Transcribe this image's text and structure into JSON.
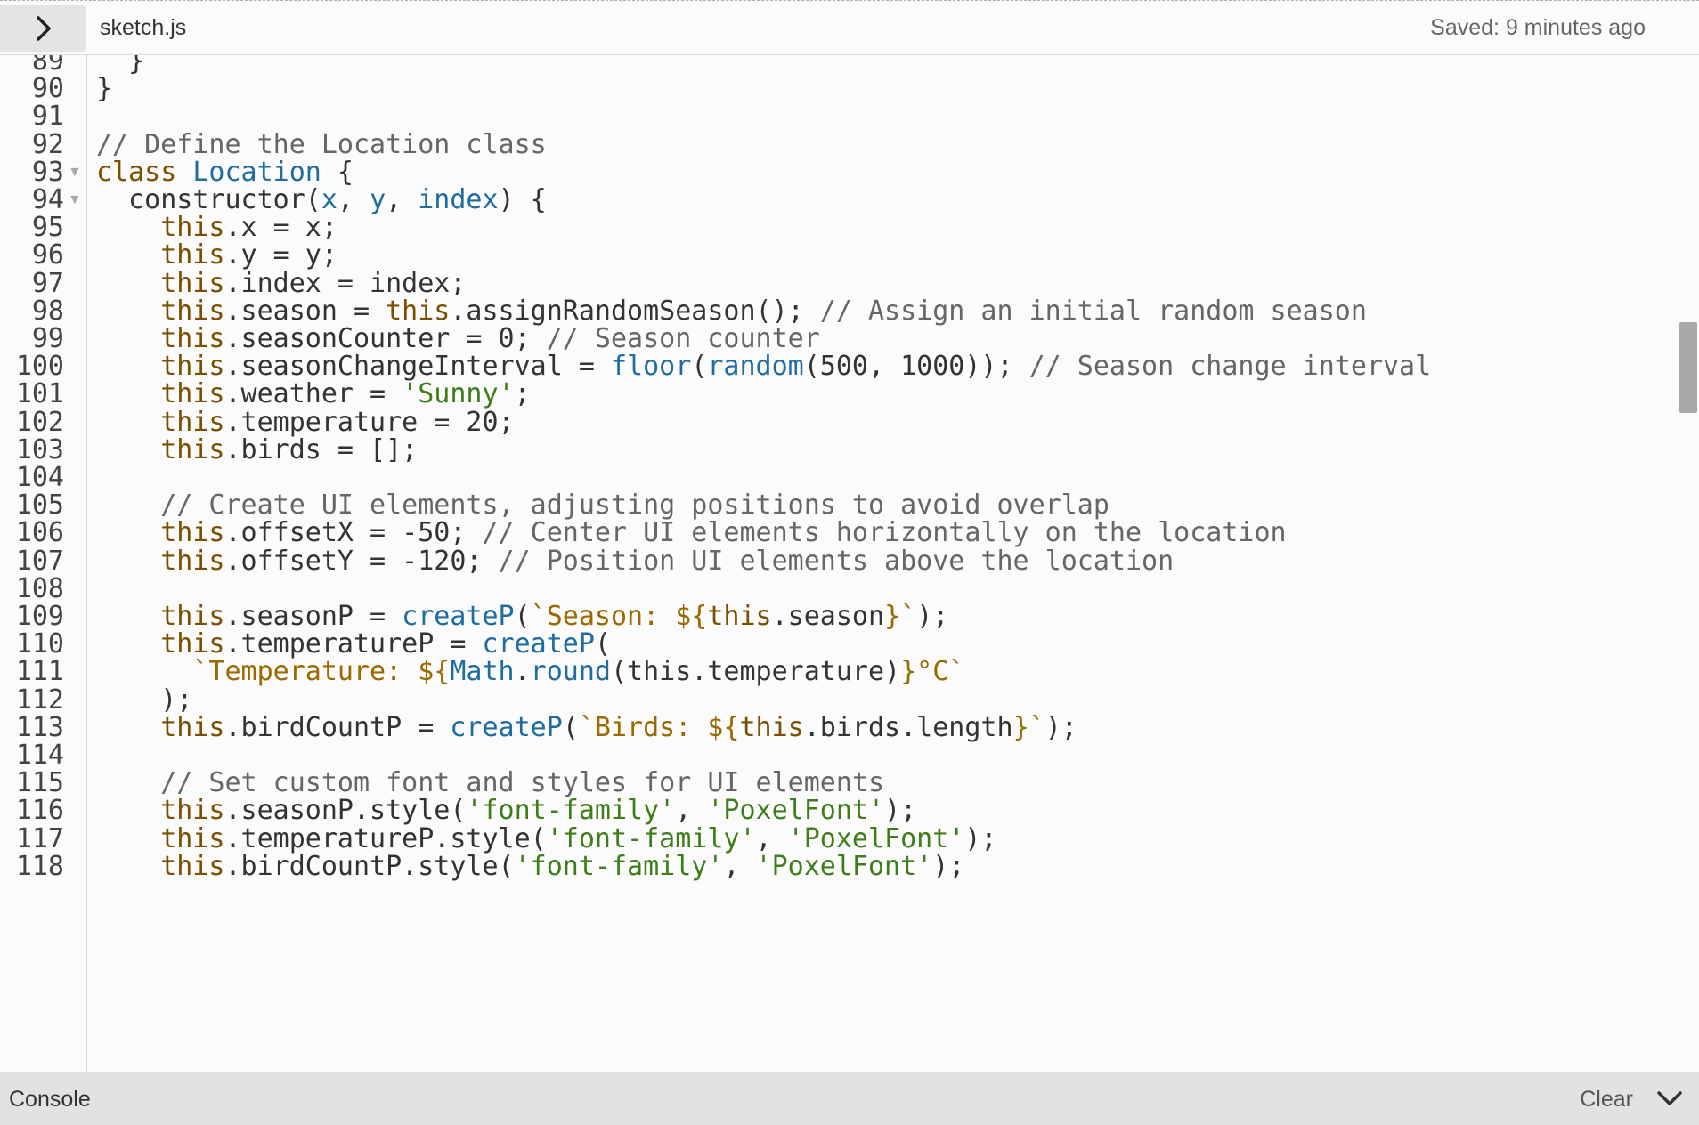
{
  "header": {
    "file_name": "sketch.js",
    "saved_status": "Saved: 9 minutes ago"
  },
  "editor": {
    "first_line": 89,
    "folded_lines": [
      93,
      94
    ],
    "lines": [
      [
        [
          "",
          "  }"
        ]
      ],
      [
        [
          "",
          "}"
        ]
      ],
      [],
      [
        [
          "comment",
          "// Define the Location class"
        ]
      ],
      [
        [
          "keyword",
          "class "
        ],
        [
          "def",
          "Location"
        ],
        [
          "",
          " {"
        ]
      ],
      [
        [
          "",
          "  constructor("
        ],
        [
          "def",
          "x"
        ],
        [
          "",
          ", "
        ],
        [
          "def",
          "y"
        ],
        [
          "",
          ", "
        ],
        [
          "def",
          "index"
        ],
        [
          "",
          ") {"
        ]
      ],
      [
        [
          "",
          "    "
        ],
        [
          "keyword",
          "this"
        ],
        [
          "",
          ".x = x;"
        ]
      ],
      [
        [
          "",
          "    "
        ],
        [
          "keyword",
          "this"
        ],
        [
          "",
          ".y = y;"
        ]
      ],
      [
        [
          "",
          "    "
        ],
        [
          "keyword",
          "this"
        ],
        [
          "",
          ".index = index;"
        ]
      ],
      [
        [
          "",
          "    "
        ],
        [
          "keyword",
          "this"
        ],
        [
          "",
          ".season = "
        ],
        [
          "keyword",
          "this"
        ],
        [
          "",
          ".assignRandomSeason(); "
        ],
        [
          "comment",
          "// Assign an initial random season"
        ]
      ],
      [
        [
          "",
          "    "
        ],
        [
          "keyword",
          "this"
        ],
        [
          "",
          ".seasonCounter = 0; "
        ],
        [
          "comment",
          "// Season counter"
        ]
      ],
      [
        [
          "",
          "    "
        ],
        [
          "keyword",
          "this"
        ],
        [
          "",
          ".seasonChangeInterval = "
        ],
        [
          "builtin",
          "floor"
        ],
        [
          "",
          "("
        ],
        [
          "builtin",
          "random"
        ],
        [
          "",
          "(500, 1000)); "
        ],
        [
          "comment",
          "// Season change interval"
        ]
      ],
      [
        [
          "",
          "    "
        ],
        [
          "keyword",
          "this"
        ],
        [
          "",
          ".weather = "
        ],
        [
          "string",
          "'Sunny'"
        ],
        [
          "",
          ";"
        ]
      ],
      [
        [
          "",
          "    "
        ],
        [
          "keyword",
          "this"
        ],
        [
          "",
          ".temperature = 20;"
        ]
      ],
      [
        [
          "",
          "    "
        ],
        [
          "keyword",
          "this"
        ],
        [
          "",
          ".birds = [];"
        ]
      ],
      [],
      [
        [
          "",
          "    "
        ],
        [
          "comment",
          "// Create UI elements, adjusting positions to avoid overlap"
        ]
      ],
      [
        [
          "",
          "    "
        ],
        [
          "keyword",
          "this"
        ],
        [
          "",
          ".offsetX = -50; "
        ],
        [
          "comment",
          "// Center UI elements horizontally on the location"
        ]
      ],
      [
        [
          "",
          "    "
        ],
        [
          "keyword",
          "this"
        ],
        [
          "",
          ".offsetY = -120; "
        ],
        [
          "comment",
          "// Position UI elements above the location"
        ]
      ],
      [],
      [
        [
          "",
          "    "
        ],
        [
          "keyword",
          "this"
        ],
        [
          "",
          ".seasonP = "
        ],
        [
          "builtin",
          "createP"
        ],
        [
          "",
          "("
        ],
        [
          "tpl",
          "`Season: ${"
        ],
        [
          "keyword",
          "this"
        ],
        [
          "",
          ".season"
        ],
        [
          "tpl",
          "}`"
        ],
        [
          "",
          ");"
        ]
      ],
      [
        [
          "",
          "    "
        ],
        [
          "keyword",
          "this"
        ],
        [
          "",
          ".temperatureP = "
        ],
        [
          "builtin",
          "createP"
        ],
        [
          "",
          "("
        ]
      ],
      [
        [
          "",
          "      "
        ],
        [
          "tpl",
          "`Temperature: ${"
        ],
        [
          "builtin",
          "Math"
        ],
        [
          "",
          "."
        ],
        [
          "builtin",
          "round"
        ],
        [
          "",
          "(this.temperature)"
        ],
        [
          "tpl",
          "}°C`"
        ]
      ],
      [
        [
          "",
          "    );"
        ]
      ],
      [
        [
          "",
          "    "
        ],
        [
          "keyword",
          "this"
        ],
        [
          "",
          ".birdCountP = "
        ],
        [
          "builtin",
          "createP"
        ],
        [
          "",
          "("
        ],
        [
          "tpl",
          "`Birds: ${"
        ],
        [
          "keyword",
          "this"
        ],
        [
          "",
          ".birds.length"
        ],
        [
          "tpl",
          "}`"
        ],
        [
          "",
          ");"
        ]
      ],
      [],
      [
        [
          "",
          "    "
        ],
        [
          "comment",
          "// Set custom font and styles for UI elements"
        ]
      ],
      [
        [
          "",
          "    "
        ],
        [
          "keyword",
          "this"
        ],
        [
          "",
          ".seasonP.style("
        ],
        [
          "string",
          "'font-family'"
        ],
        [
          "",
          ", "
        ],
        [
          "string",
          "'PoxelFont'"
        ],
        [
          "",
          ");"
        ]
      ],
      [
        [
          "",
          "    "
        ],
        [
          "keyword",
          "this"
        ],
        [
          "",
          ".temperatureP.style("
        ],
        [
          "string",
          "'font-family'"
        ],
        [
          "",
          ", "
        ],
        [
          "string",
          "'PoxelFont'"
        ],
        [
          "",
          ");"
        ]
      ],
      [
        [
          "",
          "    "
        ],
        [
          "keyword",
          "this"
        ],
        [
          "",
          ".birdCountP.style("
        ],
        [
          "string",
          "'font-family'"
        ],
        [
          "",
          ", "
        ],
        [
          "string",
          "'PoxelFont'"
        ],
        [
          "",
          ");"
        ]
      ]
    ]
  },
  "console": {
    "title": "Console",
    "clear_label": "Clear"
  },
  "icons": {
    "sidebar_toggle": "chevron-right-icon",
    "console_collapse": "chevron-down-icon"
  }
}
